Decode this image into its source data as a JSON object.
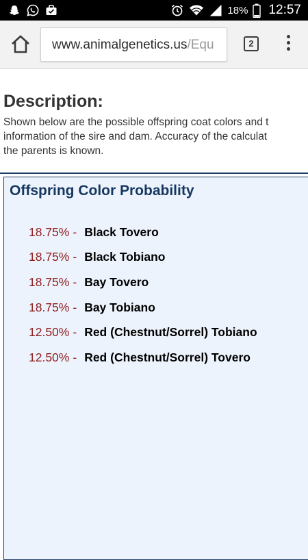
{
  "status_bar": {
    "time": "12:57",
    "battery_percent": "18%",
    "left_icons": [
      "snapchat-icon",
      "whatsapp-icon",
      "briefcase-icon"
    ],
    "right_icons": [
      "alarm-icon",
      "wifi-icon",
      "signal-icon",
      "battery-icon"
    ]
  },
  "browser": {
    "url_host": "www.animalgenetics.us",
    "url_path": "/Equ",
    "tab_count": "2",
    "icons": [
      "home-icon",
      "tabs-icon",
      "more-vert-icon"
    ]
  },
  "page": {
    "heading": "Description:",
    "description_lines": [
      "Shown below are the possible offspring coat colors and t",
      "information of the sire and dam. Accuracy of the calculat",
      "the parents is known."
    ],
    "panel_title": "Offspring Color Probability",
    "separator": "-",
    "colors": {
      "panel_background": "#edf3fc",
      "panel_border": "#1d3c62",
      "title": "#16375f",
      "percentage": "#8e1b1b"
    },
    "probabilities": [
      {
        "percent": "18.75%",
        "name": "Black Tovero"
      },
      {
        "percent": "18.75%",
        "name": "Black Tobiano"
      },
      {
        "percent": "18.75%",
        "name": "Bay Tovero"
      },
      {
        "percent": "18.75%",
        "name": "Bay Tobiano"
      },
      {
        "percent": "12.50%",
        "name": "Red (Chestnut/Sorrel) Tobiano"
      },
      {
        "percent": "12.50%",
        "name": "Red (Chestnut/Sorrel) Tovero"
      }
    ]
  }
}
